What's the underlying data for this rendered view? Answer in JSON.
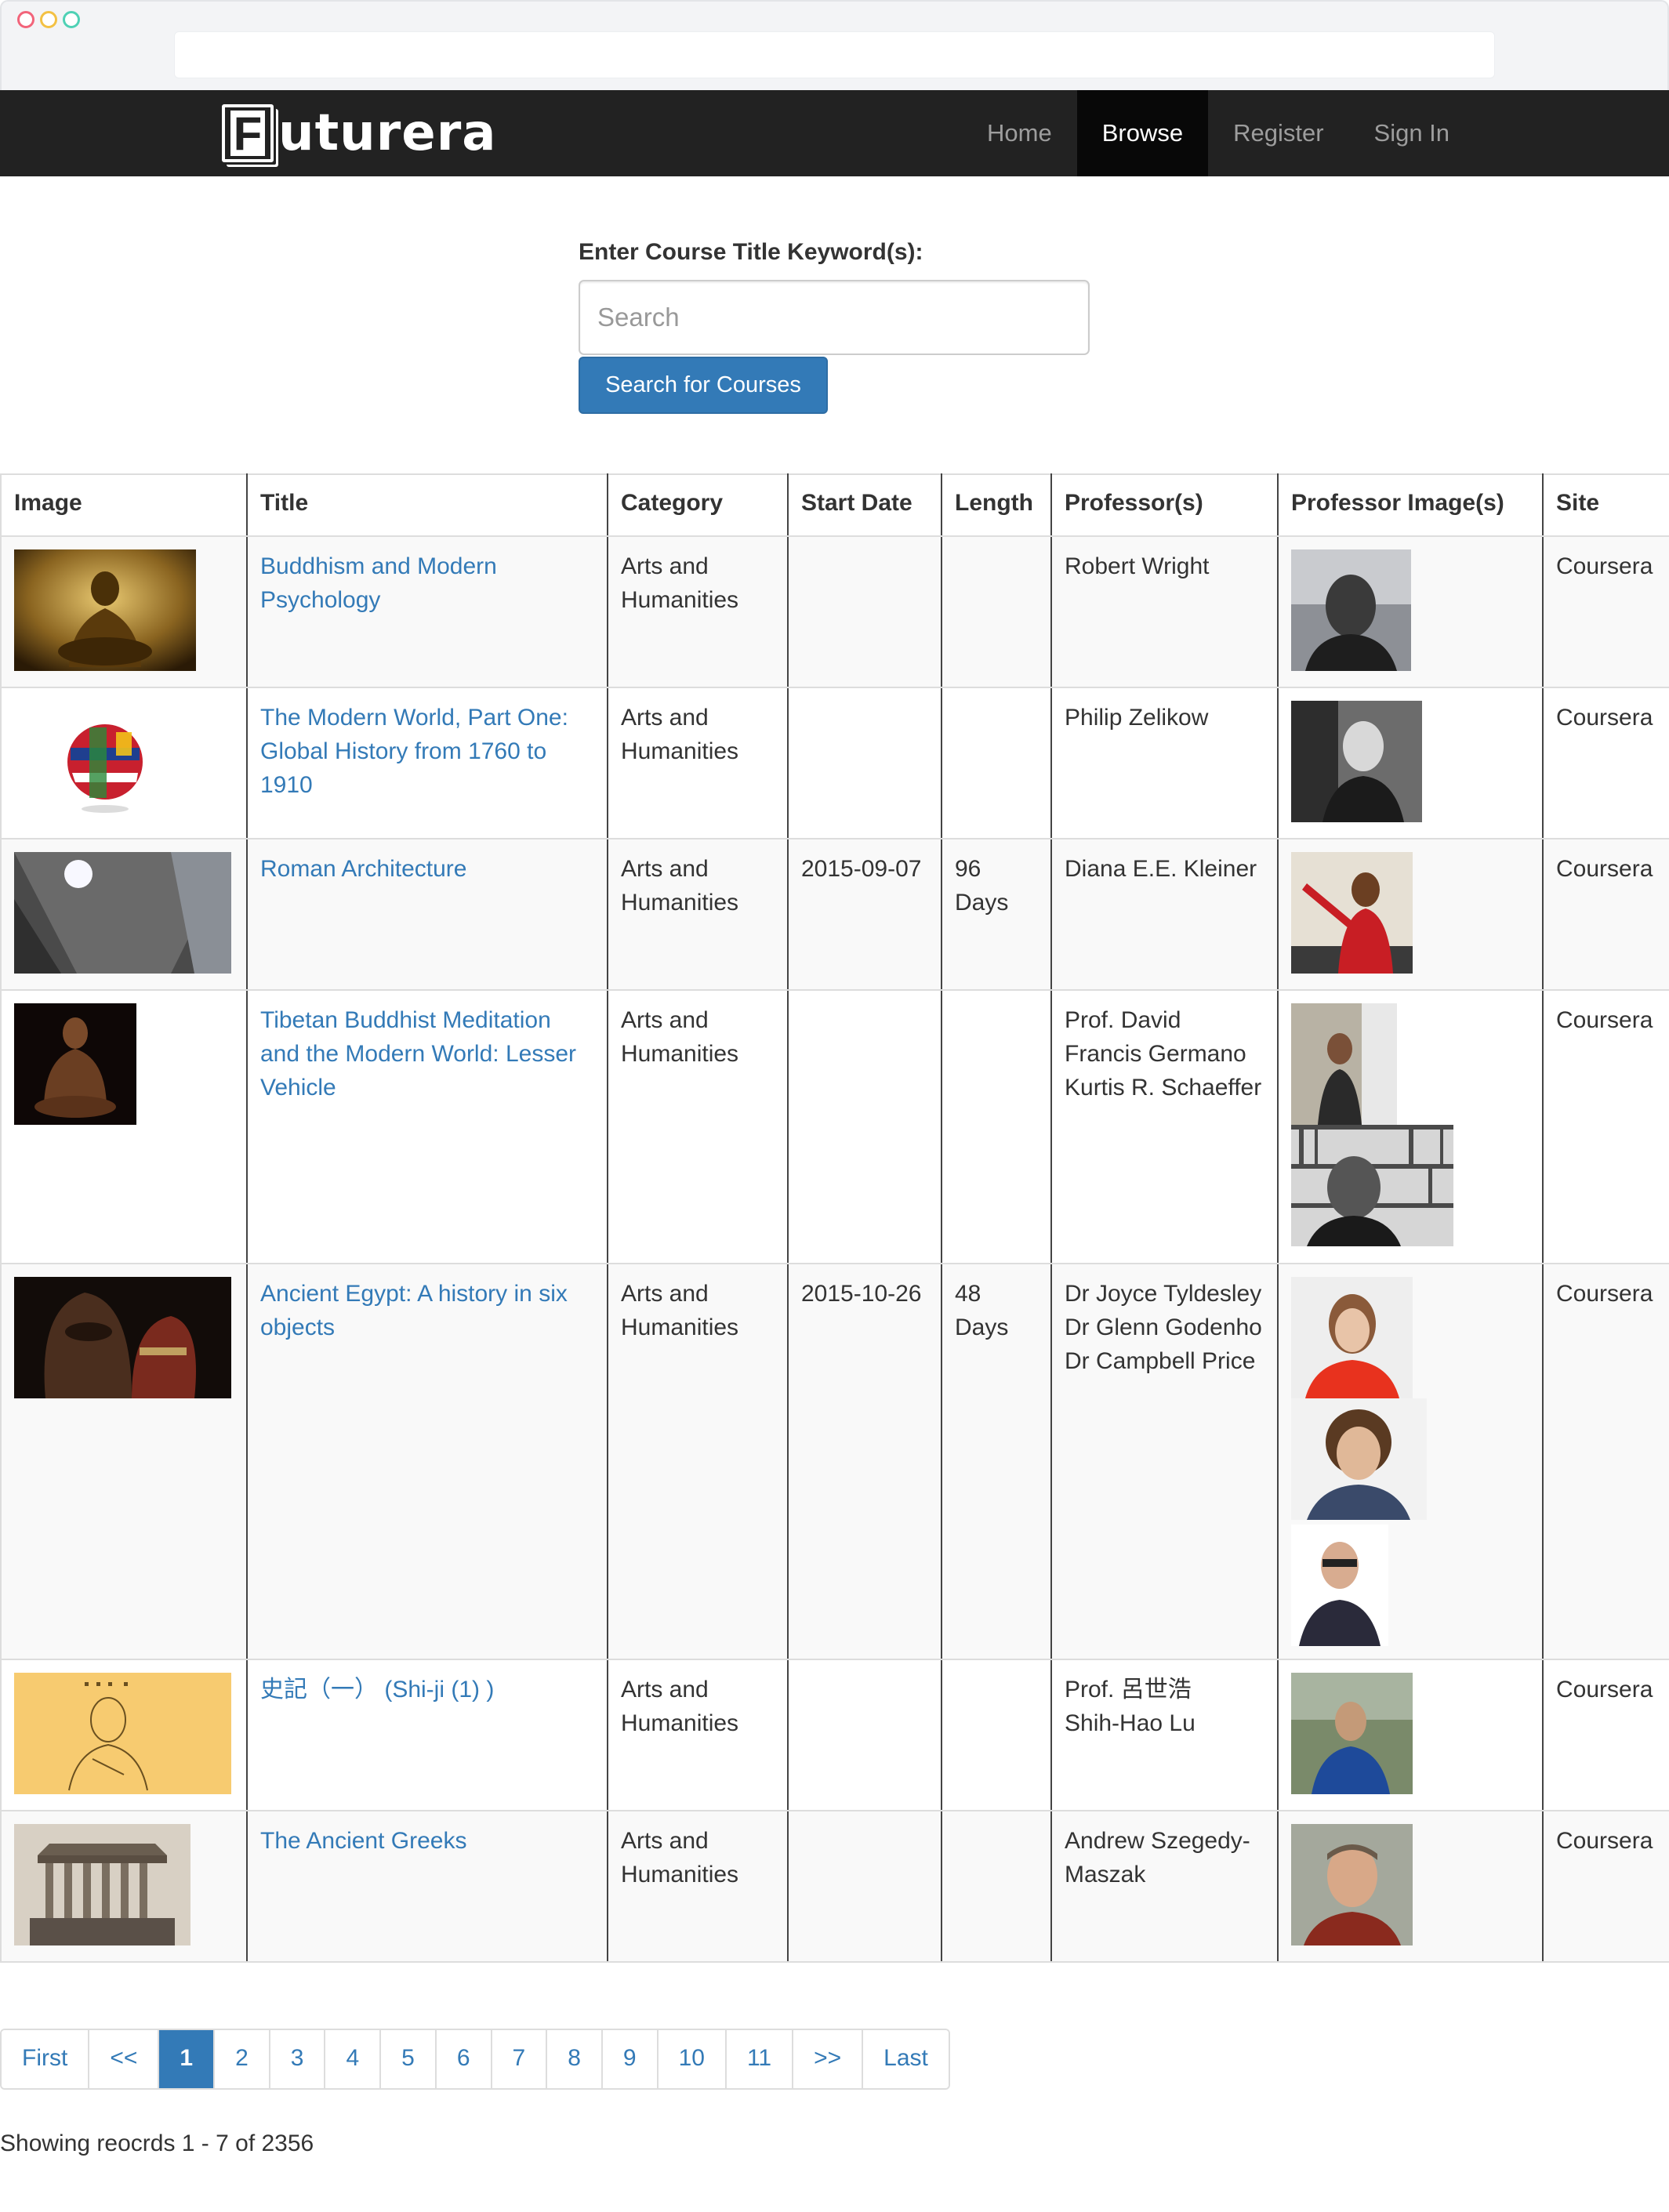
{
  "brand": {
    "name": "Futurera",
    "logo_letter": "F"
  },
  "nav": [
    {
      "label": "Home",
      "active": false
    },
    {
      "label": "Browse",
      "active": true
    },
    {
      "label": "Register",
      "active": false
    },
    {
      "label": "Sign In",
      "active": false
    }
  ],
  "search": {
    "label": "Enter Course Title Keyword(s):",
    "placeholder": "Search",
    "value": "",
    "button_label": "Search for Courses"
  },
  "table": {
    "headers": [
      "Image",
      "Title",
      "Category",
      "Start Date",
      "Length",
      "Professor(s)",
      "Professor Image(s)",
      "Site"
    ],
    "rows": [
      {
        "title": "Buddhism and Modern Psychology",
        "category": "Arts and Humanities",
        "start_date": "",
        "length": "",
        "professors": [
          "Robert Wright"
        ],
        "site": "Coursera",
        "image_icon": "buddha-statue-image",
        "prof_images": [
          "robert-wright-photo"
        ]
      },
      {
        "title": "The Modern World, Part One: Global History from 1760 to 1910",
        "category": "Arts and Humanities",
        "start_date": "",
        "length": "",
        "professors": [
          "Philip Zelikow"
        ],
        "site": "Coursera",
        "image_icon": "flag-globe-image",
        "prof_images": [
          "philip-zelikow-photo"
        ]
      },
      {
        "title": "Roman Architecture",
        "category": "Arts and Humanities",
        "start_date": "2015-09-07",
        "length": "96 Days",
        "professors": [
          "Diana E.E. Kleiner"
        ],
        "site": "Coursera",
        "image_icon": "pantheon-dome-image",
        "prof_images": [
          "diana-kleiner-photo"
        ]
      },
      {
        "title": "Tibetan Buddhist Meditation and the Modern World: Lesser Vehicle",
        "category": "Arts and Humanities",
        "start_date": "",
        "length": "",
        "professors": [
          "Prof. David Francis Germano",
          "Kurtis R. Schaeffer"
        ],
        "site": "Coursera",
        "image_icon": "bronze-buddha-image",
        "prof_images": [
          "david-germano-photo",
          "kurtis-schaeffer-photo"
        ]
      },
      {
        "title": "Ancient Egypt: A history in six objects",
        "category": "Arts and Humanities",
        "start_date": "2015-10-26",
        "length": "48 Days",
        "professors": [
          "Dr Joyce Tyldesley",
          "Dr Glenn Godenho",
          "Dr Campbell Price"
        ],
        "site": "Coursera",
        "image_icon": "egyptian-mask-image",
        "prof_images": [
          "joyce-tyldesley-photo",
          "glenn-godenho-photo",
          "campbell-price-photo"
        ]
      },
      {
        "title": "史記（一） (Shi-ji (1) )",
        "category": "Arts and Humanities",
        "start_date": "",
        "length": "",
        "professors": [
          "Prof. 呂世浩",
          "Shih-Hao Lu"
        ],
        "site": "Coursera",
        "image_icon": "chinese-sketch-image",
        "prof_images": [
          "shih-hao-lu-photo"
        ]
      },
      {
        "title": "The Ancient Greeks",
        "category": "Arts and Humanities",
        "start_date": "",
        "length": "",
        "professors": [
          "Andrew Szegedy-Maszak"
        ],
        "site": "Coursera",
        "image_icon": "parthenon-image",
        "prof_images": [
          "andrew-szegedy-maszak-photo"
        ]
      }
    ]
  },
  "pagination": {
    "items": [
      "First",
      "<<",
      "1",
      "2",
      "3",
      "4",
      "5",
      "6",
      "7",
      "8",
      "9",
      "10",
      "11",
      ">>",
      "Last"
    ],
    "active": "1"
  },
  "records_text": "Showing reocrds 1 - 7 of 2356",
  "colors": {
    "navbar": "#222222",
    "link": "#337ab7",
    "button": "#337ab7"
  }
}
